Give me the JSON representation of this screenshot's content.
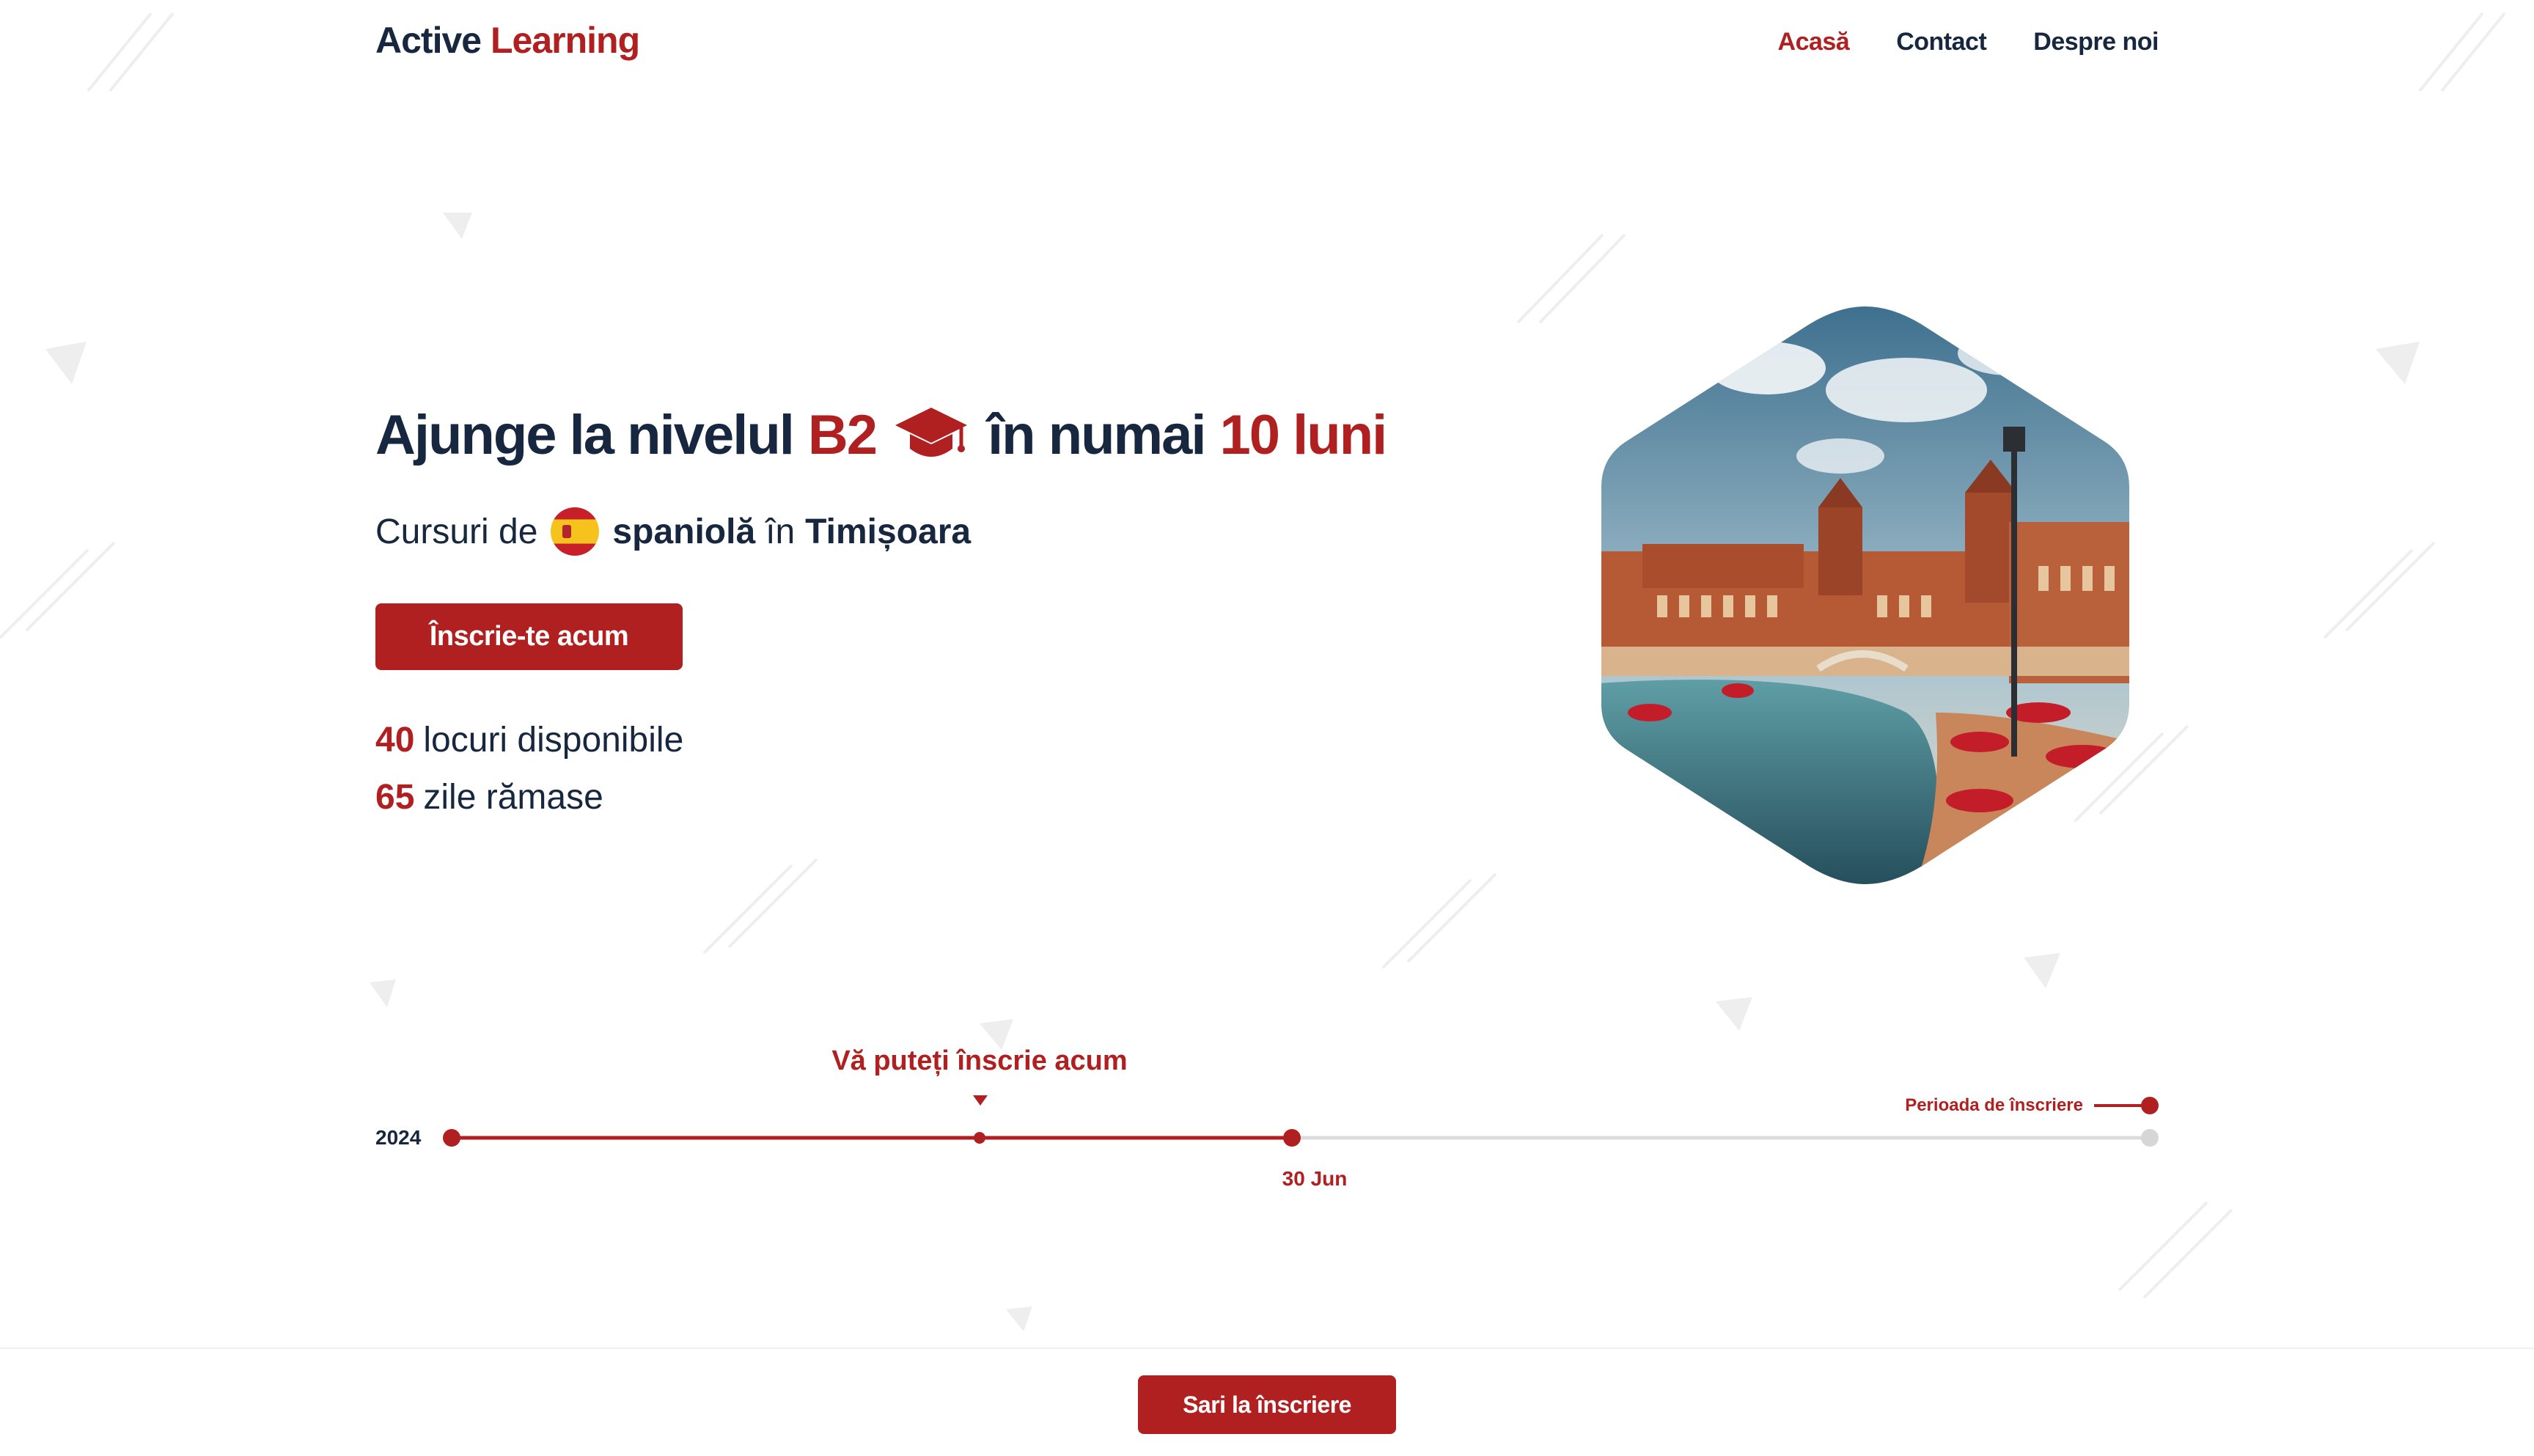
{
  "brand": {
    "part1": "Active",
    "part2": "Learning"
  },
  "nav": {
    "items": [
      {
        "label": "Acasă",
        "active": true
      },
      {
        "label": "Contact",
        "active": false
      },
      {
        "label": "Despre noi",
        "active": false
      }
    ]
  },
  "hero": {
    "headline": {
      "part1": "Ajunge la nivelul",
      "level": "B2",
      "part2": "în numai",
      "duration": "10 luni"
    },
    "subline": {
      "prefix": "Cursuri de",
      "language": "spaniolă",
      "connector": "în",
      "city": "Timișoara"
    },
    "cta_label": "Înscrie-te acum",
    "stats": [
      {
        "number": "40",
        "label": "locuri disponibile"
      },
      {
        "number": "65",
        "label": "zile rămase"
      }
    ],
    "image_subject": "Plaza de España, Sevilla"
  },
  "timeline": {
    "year": "2024",
    "now_label": "Vă puteți înscrie acum",
    "date_label": "30 Jun",
    "legend_label": "Perioada de înscriere"
  },
  "footer": {
    "button_label": "Sari la înscriere"
  },
  "colors": {
    "accent": "#b02020",
    "text": "#16273f",
    "track": "#dcdcdc"
  },
  "icons": [
    "graduation-cap-icon",
    "spain-flag-icon"
  ]
}
